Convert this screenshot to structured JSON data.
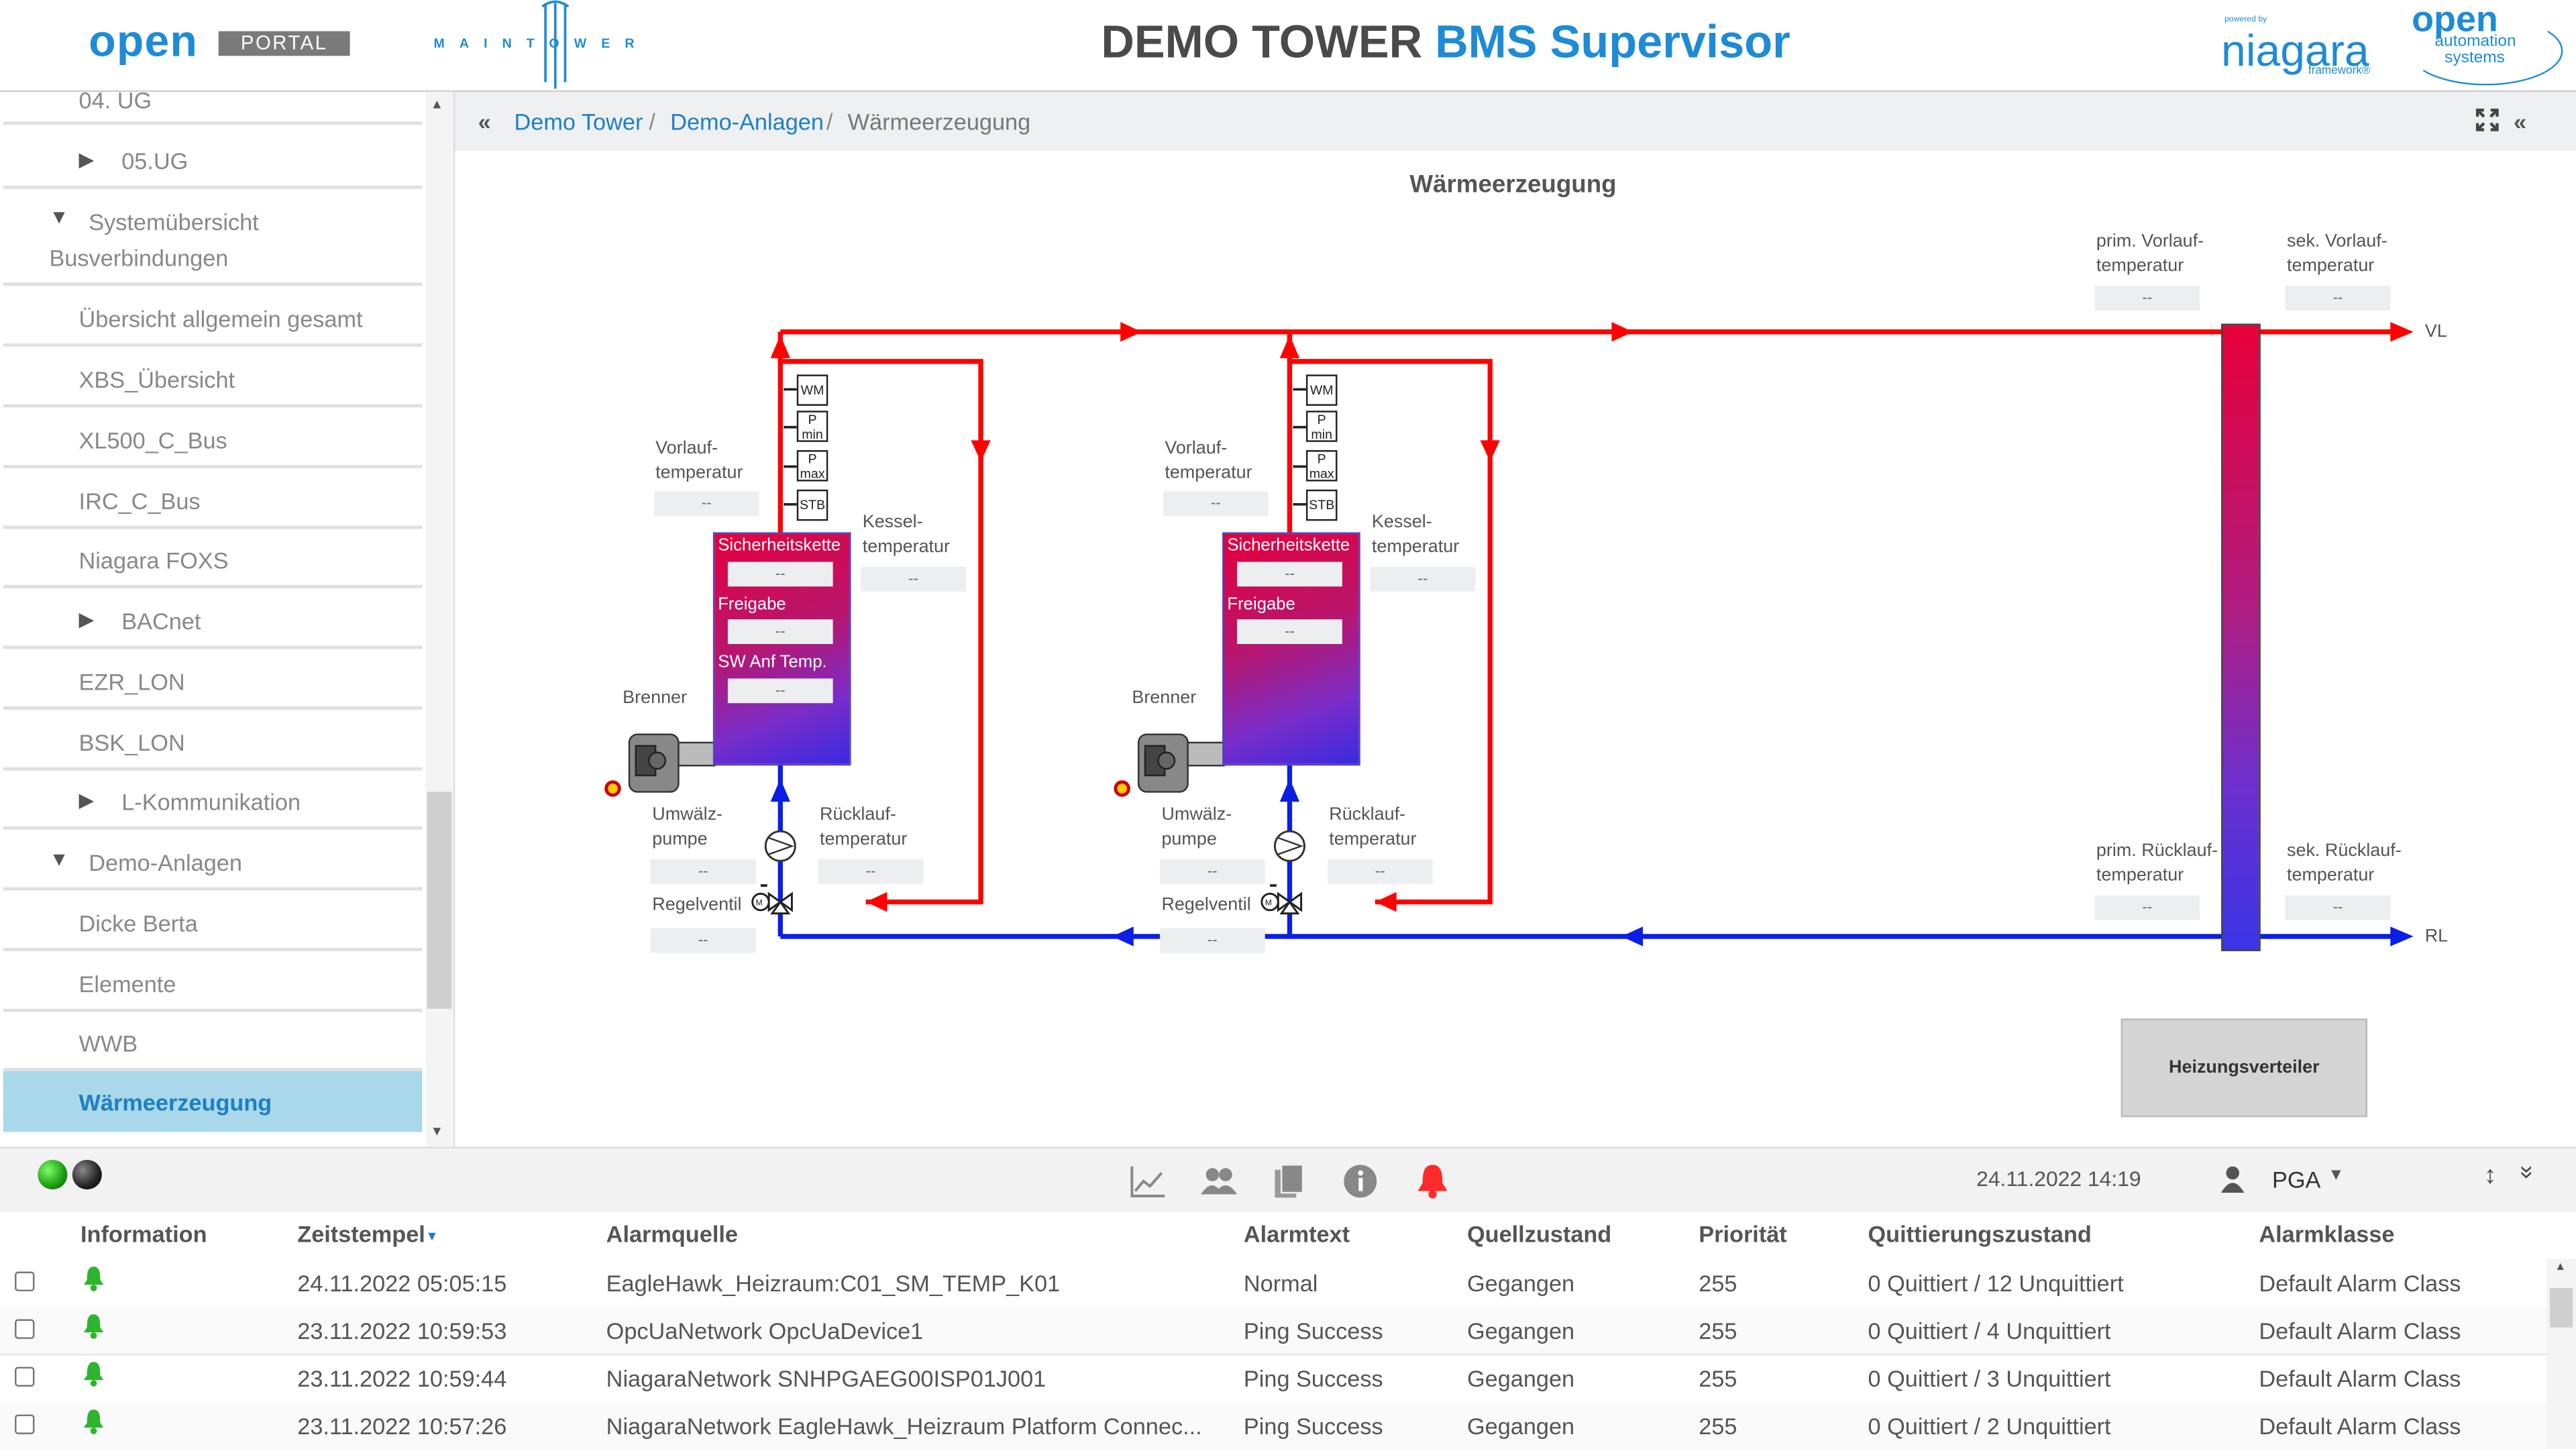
{
  "header": {
    "logo_open": "open",
    "logo_portal": "PORTAL",
    "logo_tower": "MAINTOWER",
    "title_main": "DEMO TOWER ",
    "title_accent": "BMS Supervisor",
    "niagara_powered": "powered by",
    "niagara": "niagara",
    "niagara_fw": "framework®",
    "oas_open": "open",
    "oas_line1": "automation",
    "oas_line2": "systems"
  },
  "sidebar": {
    "items": [
      {
        "label": "04. UG",
        "arrow": ""
      },
      {
        "label": "05.UG",
        "arrow": "▶"
      },
      {
        "label": "Systemübersicht",
        "label2": "Busverbindungen",
        "arrow": "▼"
      },
      {
        "label": "Übersicht allgemein gesamt",
        "arrow": ""
      },
      {
        "label": "XBS_Übersicht",
        "arrow": ""
      },
      {
        "label": "XL500_C_Bus",
        "arrow": ""
      },
      {
        "label": "IRC_C_Bus",
        "arrow": ""
      },
      {
        "label": "Niagara FOXS",
        "arrow": ""
      },
      {
        "label": "BACnet",
        "arrow": "▶"
      },
      {
        "label": "EZR_LON",
        "arrow": ""
      },
      {
        "label": "BSK_LON",
        "arrow": ""
      },
      {
        "label": "L-Kommunikation",
        "arrow": "▶"
      },
      {
        "label": "Demo-Anlagen",
        "arrow": "▼"
      },
      {
        "label": "Dicke Berta",
        "arrow": ""
      },
      {
        "label": "Elemente",
        "arrow": ""
      },
      {
        "label": "WWB",
        "arrow": ""
      },
      {
        "label": "Wärmeerzeugung",
        "arrow": ""
      }
    ]
  },
  "breadcrumb": {
    "items": [
      "Demo Tower",
      "Demo-Anlagen",
      "Wärmeerzeugung"
    ],
    "sep": "/"
  },
  "diagram": {
    "title": "Wärmeerzeugung",
    "placeholder": "--",
    "vorlauf": "Vorlauf-",
    "temperatur": "temperatur",
    "kessel": "Kessel-",
    "brenner": "Brenner",
    "umwaelz": "Umwälz-",
    "pumpe": "pumpe",
    "ruecklauf": "Rücklauf-",
    "regelventil": "Regelventil",
    "sicherheitskette": "Sicherheitskette",
    "freigabe": "Freigabe",
    "sw_anf": "SW Anf Temp.",
    "prim_vorlauf": "prim. Vorlauf-",
    "sek_vorlauf": "sek. Vorlauf-",
    "prim_ruecklauf": "prim. Rücklauf-",
    "sek_ruecklauf": "sek. Rücklauf-",
    "vl": "VL",
    "rl": "RL",
    "wm": "WM",
    "p": "P",
    "min": "min",
    "max": "max",
    "stb": "STB",
    "motor": "M",
    "heizungsverteiler": "Heizungsverteiler",
    "supply_color": "#ff0000",
    "return_color": "#0a1ee6"
  },
  "toolbar": {
    "date": "24.11.2022 14:19",
    "user": "PGA"
  },
  "table": {
    "headers": [
      "Information",
      "Zeitstempel",
      "Alarmquelle",
      "Alarmtext",
      "Quellzustand",
      "Priorität",
      "Quittierungszustand",
      "Alarmklasse"
    ],
    "rows": [
      [
        "24.11.2022 05:05:15",
        "EagleHawk_Heizraum:C01_SM_TEMP_K01",
        "Normal",
        "Gegangen",
        "255",
        "0 Quittiert / 12 Unquittiert",
        "Default Alarm Class"
      ],
      [
        "23.11.2022 10:59:53",
        "OpcUaNetwork OpcUaDevice1",
        "Ping Success",
        "Gegangen",
        "255",
        "0 Quittiert / 4 Unquittiert",
        "Default Alarm Class"
      ],
      [
        "23.11.2022 10:59:44",
        "NiagaraNetwork SNHPGAEG00ISP01J001",
        "Ping Success",
        "Gegangen",
        "255",
        "0 Quittiert / 3 Unquittiert",
        "Default Alarm Class"
      ],
      [
        "23.11.2022 10:57:26",
        "NiagaraNetwork EagleHawk_Heizraum Platform Connec...",
        "Ping Success",
        "Gegangen",
        "255",
        "0 Quittiert / 2 Unquittiert",
        "Default Alarm Class"
      ]
    ]
  }
}
